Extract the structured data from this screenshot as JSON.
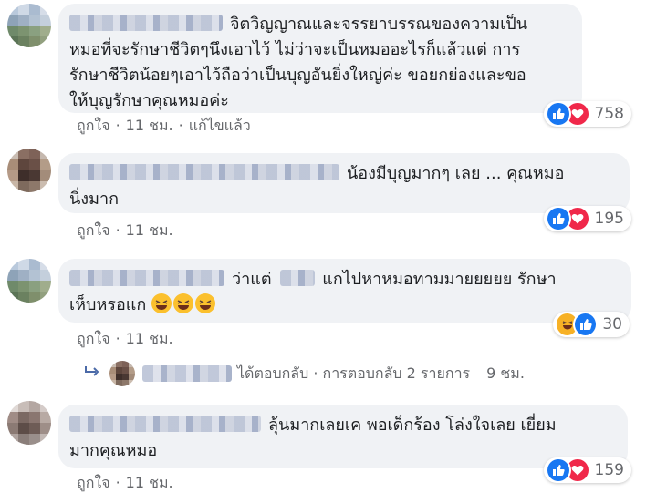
{
  "comments": [
    {
      "lines": [
        "จิตวิญญาณและจรรยาบรรณของความเป็น",
        "หมอที่จะรักษาชีวิตๆนึงเอาไว้ ไม่ว่าจะเป็นหมออะไรก็แล้วแต่ การ",
        "รักษาชีวิตน้อยๆเอาไว้ถือว่าเป็นบุญอันยิ่งใหญ่ค่ะ ขอยกย่องและขอ",
        "ให้บุญรักษาคุณหมอค่ะ"
      ],
      "like": "ถูกใจ",
      "time": "11 ชม.",
      "edited": "แก้ไขแล้ว",
      "reaction_count": "758"
    },
    {
      "lines": [
        "น้องมีบุญมากๆ เลย ... คุณหมอ",
        "นิ่งมาก"
      ],
      "like": "ถูกใจ",
      "time": "11 ชม.",
      "reaction_count": "195"
    },
    {
      "lines": [
        "ว่าแต่",
        "แกไปหาหมอทามมายยยยย รักษา",
        "เห็บหรอแก"
      ],
      "like": "ถูกใจ",
      "time": "11 ชม.",
      "reaction_count": "30"
    },
    {
      "lines": [
        "ลุ้นมากเลยเค พอเด็กร้อง โล่งใจเลย เยี่ยม",
        "มากคุณหมอ"
      ],
      "like": "ถูกใจ",
      "time": "11 ชม.",
      "reaction_count": "159"
    }
  ],
  "reply_summary": {
    "text": "ได้ตอบกลับ · การตอบกลับ 2 รายการ",
    "time": "9 ชม."
  },
  "icons": {
    "like": "thumbs-up-icon",
    "love": "heart-icon",
    "haha": "laughing-face-icon",
    "reply": "reply-arrow-icon"
  },
  "colors": {
    "bubble": "#f0f2f5",
    "meta": "#65676b",
    "like": "#1877f2",
    "love": "#f0284a",
    "haha": "#f7b125"
  }
}
